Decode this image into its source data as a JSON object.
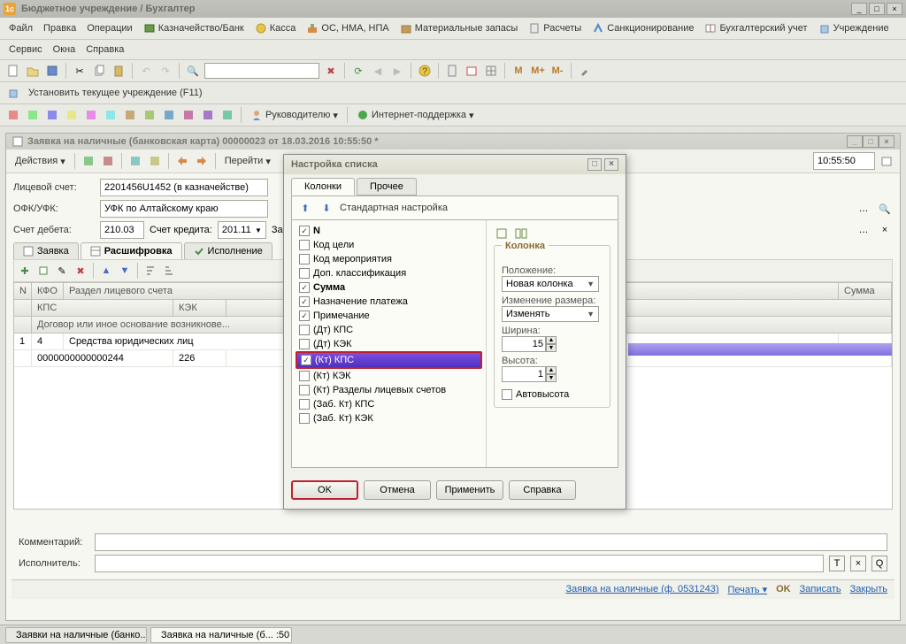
{
  "app": {
    "title": "Бюджетное учреждение / Бухгалтер"
  },
  "menu": {
    "file": "Файл",
    "edit": "Правка",
    "ops": "Операции",
    "treasury": "Казначейство/Банк",
    "cash": "Касса",
    "assets": "ОС, НМА, НПА",
    "stock": "Материальные запасы",
    "calc": "Расчеты",
    "sanction": "Санкционирование",
    "acct": "Бухгалтерский учет",
    "org": "Учреждение",
    "service": "Сервис",
    "windows": "Окна",
    "help": "Справка"
  },
  "toolbar2": {
    "set_current": "Установить текущее учреждение (F11)",
    "leader": "Руководителю",
    "support": "Интернет-поддержка"
  },
  "doc": {
    "title": "Заявка на наличные (банковская карта) 00000023 от 18.03.2016 10:55:50 *",
    "actions": "Действия",
    "goto": "Перейти",
    "account_label": "Лицевой счет:",
    "account_val": "2201456U1452 (в казначействе)",
    "ofk_label": "ОФК/УФК:",
    "ofk_val": "УФК по Алтайскому краю",
    "debit_label": "Счет дебета:",
    "debit_val": "210.03",
    "credit_label": "Счет кредита:",
    "credit_val": "201.11",
    "zab_label": "Заб. сче",
    "time": "10:55:50",
    "tabs": {
      "request": "Заявка",
      "detail": "Расшифровка",
      "exec": "Исполнение"
    },
    "cols": {
      "n": "N",
      "kfo": "КФО",
      "section": "Раздел лицевого счета",
      "sum": "Сумма",
      "kps": "КПС",
      "kek": "КЭК",
      "contract": "Договор или иное основание возникнове..."
    },
    "row": {
      "n": "1",
      "kfo": "4",
      "section": "Средства юридических лиц",
      "kps": "0000000000000244",
      "kek": "226"
    },
    "comment_label": "Комментарий:",
    "exec_label": "Исполнитель:"
  },
  "dialog": {
    "title": "Настройка списка",
    "tab_cols": "Колонки",
    "tab_other": "Прочее",
    "std": "Стандартная настройка",
    "items": [
      {
        "label": "N",
        "checked": true,
        "bold": true
      },
      {
        "label": "Код цели",
        "checked": false
      },
      {
        "label": "Код мероприятия",
        "checked": false
      },
      {
        "label": "Доп. классификация",
        "checked": false
      },
      {
        "label": "Сумма",
        "checked": true,
        "bold": true
      },
      {
        "label": "Назначение платежа",
        "checked": true
      },
      {
        "label": "Примечание",
        "checked": true
      },
      {
        "label": "(Дт) КПС",
        "checked": false
      },
      {
        "label": "(Дт) КЭК",
        "checked": false
      },
      {
        "label": "(Кт) КПС",
        "checked": true,
        "selected": true
      },
      {
        "label": "(Кт) КЭК",
        "checked": false
      },
      {
        "label": "(Кт) Разделы лицевых счетов",
        "checked": false
      },
      {
        "label": "(Заб. Кт) КПС",
        "checked": false
      },
      {
        "label": "(Заб. Кт) КЭК",
        "checked": false
      }
    ],
    "group": "Колонка",
    "pos_label": "Положение:",
    "pos_val": "Новая колонка",
    "resize_label": "Изменение размера:",
    "resize_val": "Изменять",
    "width_label": "Ширина:",
    "width_val": "15",
    "height_label": "Высота:",
    "height_val": "1",
    "autoh": "Автовысота",
    "ok": "OK",
    "cancel": "Отмена",
    "apply": "Применить",
    "help": "Справка"
  },
  "status": {
    "form": "Заявка на наличные (ф. 0531243)",
    "print": "Печать",
    "ok": "OK",
    "save": "Записать",
    "close": "Закрыть"
  },
  "tasks": {
    "t1": "Заявки на наличные (банко...",
    "t2": "Заявка на наличные (б... :50 *"
  }
}
